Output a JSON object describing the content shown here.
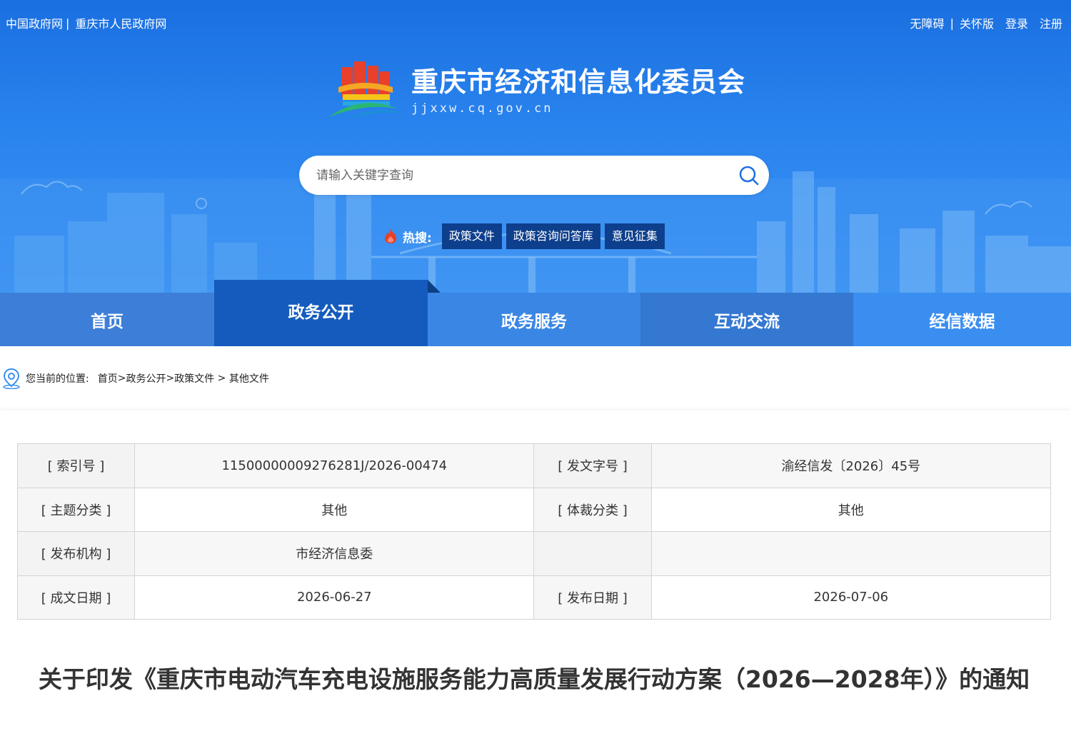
{
  "top_links": {
    "left": [
      "中国政府网",
      "重庆市人民政府网"
    ],
    "right": [
      "无障碍",
      "关怀版",
      "登录",
      "注册"
    ]
  },
  "site": {
    "title": "重庆市经济和信息化委员会",
    "domain": "jjxxw.cq.gov.cn"
  },
  "search": {
    "placeholder": "请输入关键字查询"
  },
  "hot": {
    "label": "热搜:",
    "tags": [
      "政策文件",
      "政策咨询问答库",
      "意见征集"
    ]
  },
  "nav": {
    "items": [
      "首页",
      "政务公开",
      "政务服务",
      "互动交流",
      "经信数据"
    ],
    "active_index": 1
  },
  "breadcrumb": {
    "label": "您当前的位置:",
    "path": [
      "首页",
      ">",
      "政务公开",
      ">",
      "政策文件",
      " > ",
      "其他文件"
    ]
  },
  "meta": {
    "rows": [
      [
        "[ 索引号 ]",
        "11500000009276281J/2026-00474",
        "[ 发文字号 ]",
        "渝经信发〔2026〕45号"
      ],
      [
        "[ 主题分类 ]",
        "其他",
        "[ 体裁分类 ]",
        "其他"
      ],
      [
        "[ 发布机构 ]",
        "市经济信息委",
        "",
        ""
      ],
      [
        "[ 成文日期 ]",
        "2026-06-27",
        "[ 发布日期 ]",
        "2026-07-06"
      ]
    ]
  },
  "document": {
    "title": "关于印发《重庆市电动汽车充电设施服务能力高质量发展行动方案（2026—2028年）》的通知"
  },
  "colors": {
    "banner_top": "#1a6fe0",
    "nav_dark": "#145bbd",
    "hot_tag_bg": "#0d3f8c"
  }
}
